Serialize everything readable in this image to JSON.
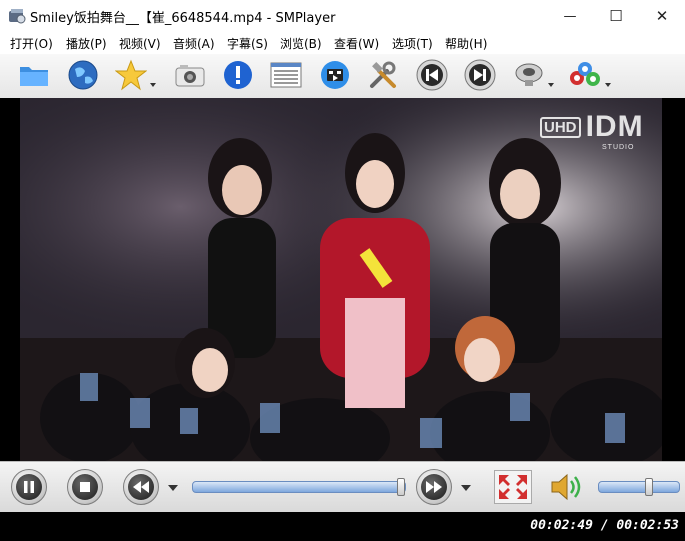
{
  "window": {
    "title": "Smiley饭拍舞台__【崔_6648544.mp4 - SMPlayer",
    "minimize_glyph": "—",
    "maximize_glyph": "☐",
    "close_glyph": "✕"
  },
  "menu": [
    {
      "label": "打开(O)"
    },
    {
      "label": "播放(P)"
    },
    {
      "label": "视频(V)"
    },
    {
      "label": "音频(A)"
    },
    {
      "label": "字幕(S)"
    },
    {
      "label": "浏览(B)"
    },
    {
      "label": "查看(W)"
    },
    {
      "label": "选项(T)"
    },
    {
      "label": "帮助(H)"
    }
  ],
  "toolbar": {
    "icons": [
      "folder-icon",
      "globe-icon",
      "favorites-star-icon",
      "screenshot-camera-icon",
      "info-icon",
      "playlist-icon",
      "video-equalizer-icon",
      "preferences-tools-icon",
      "previous-icon",
      "next-icon",
      "audio-track-icon",
      "subtitles-abc-icon"
    ]
  },
  "video": {
    "watermark_uhd": "UHD",
    "watermark_idm": "IDM",
    "watermark_sub": "STUDIO"
  },
  "playback": {
    "progress_fraction": 0.986,
    "volume_fraction": 0.62
  },
  "status": {
    "time_display": "00:02:49 / 00:02:53"
  },
  "colors": {
    "seek_fill": "#7ea7dd",
    "status_bg": "#000000",
    "status_text": "#ffffff",
    "accent_red": "#d22f2f"
  }
}
